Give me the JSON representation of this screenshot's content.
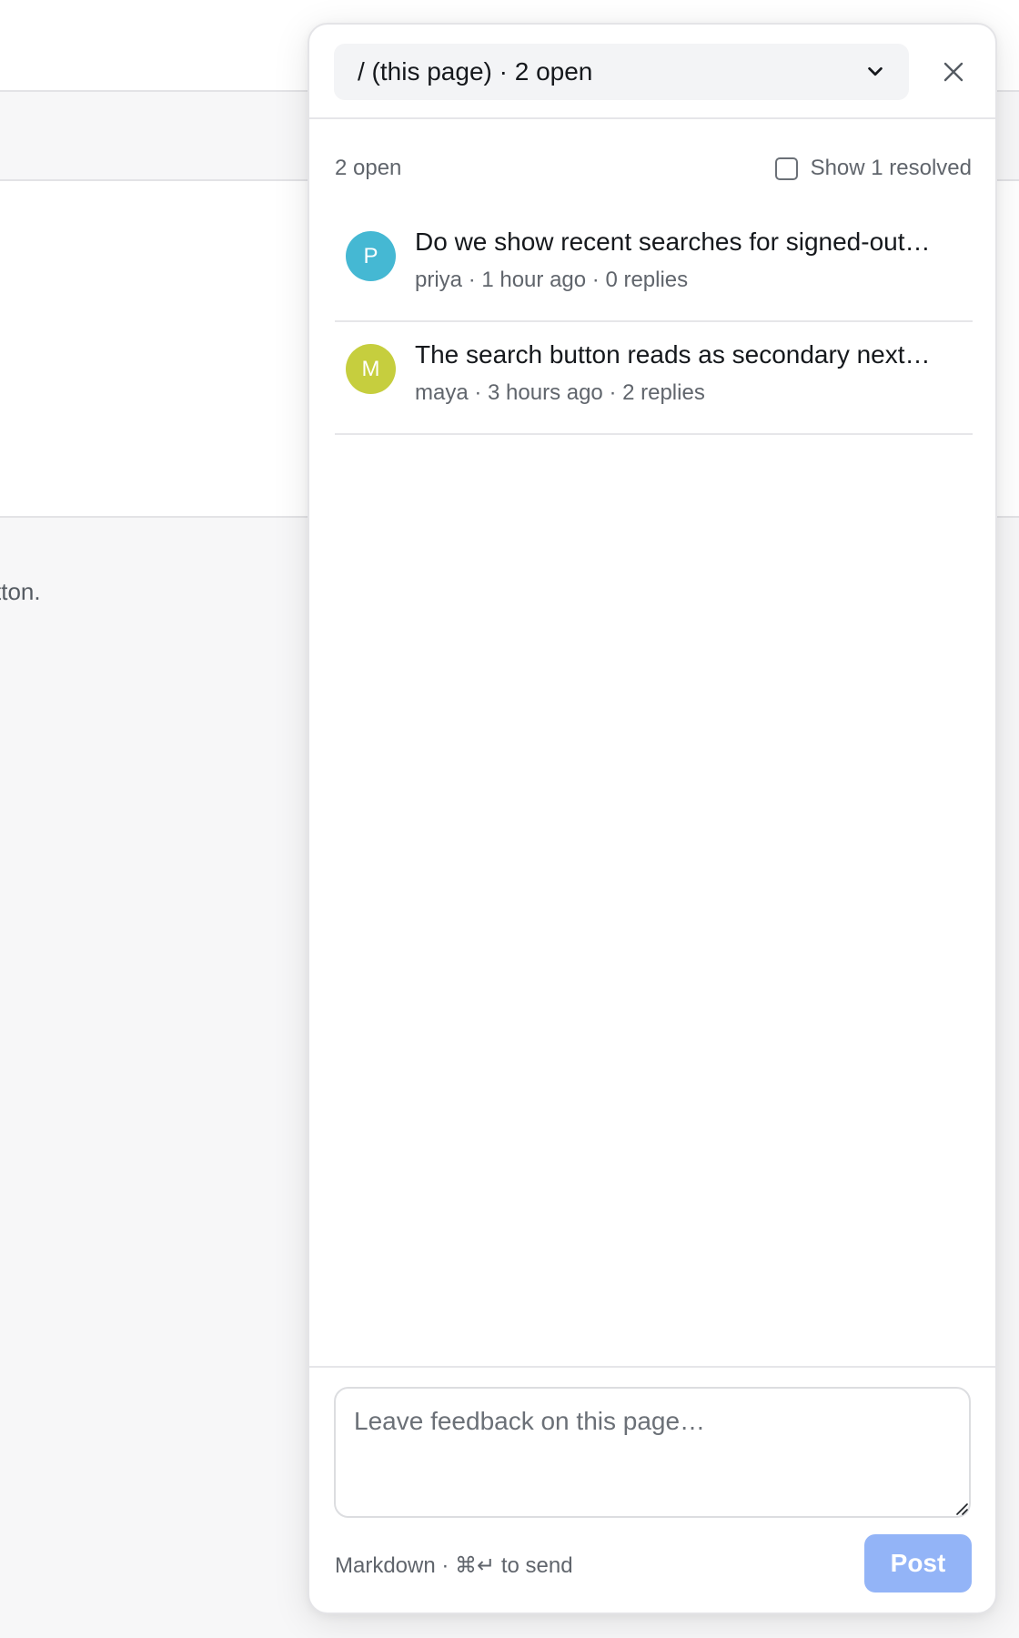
{
  "background": {
    "partial_text": "tton."
  },
  "panel": {
    "page_selector": {
      "label": "/ (this page) · 2 open",
      "icon": "chevron-down-icon"
    },
    "close_icon": "close-icon",
    "open_count": "2 open",
    "show_resolved_label": "Show 1 resolved",
    "show_resolved_checked": false,
    "threads": [
      {
        "avatar_initial": "P",
        "avatar_color": "#45b8d3",
        "title": "Do we show recent searches for signed-out…",
        "meta": "priya · 1 hour ago · 0 replies"
      },
      {
        "avatar_initial": "M",
        "avatar_color": "#c6ce3e",
        "title": "The search button reads as secondary next…",
        "meta": "maya · 3 hours ago · 2 replies"
      }
    ],
    "composer": {
      "value": "",
      "placeholder": "Leave feedback on this page…",
      "hint": "Markdown · ⌘↵ to send",
      "post_label": "Post"
    }
  }
}
